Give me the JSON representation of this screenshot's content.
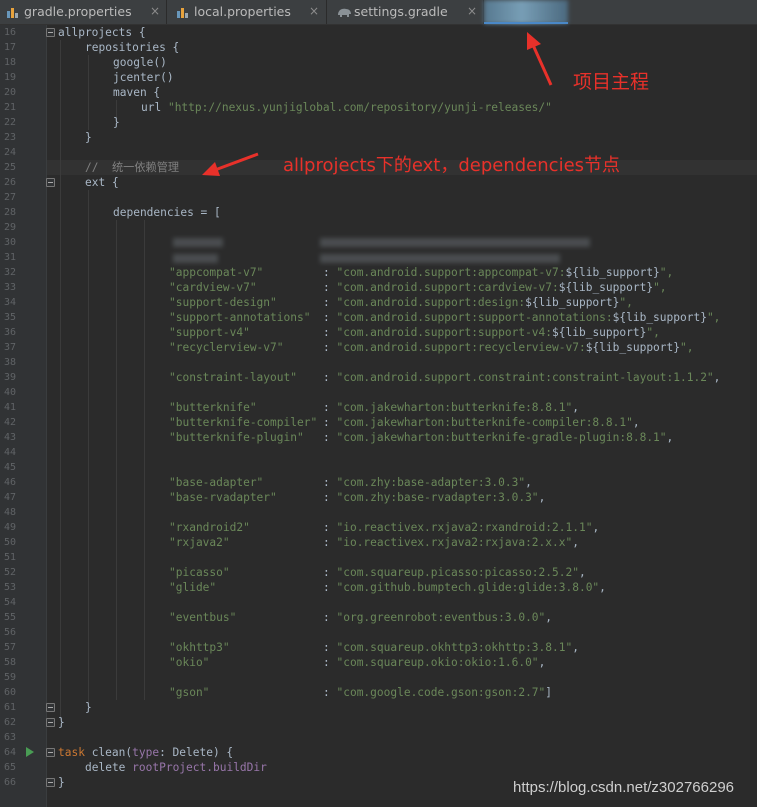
{
  "tabs": [
    {
      "label": "gradle.properties",
      "icon": "gradle-properties-icon",
      "close": "×"
    },
    {
      "label": "local.properties",
      "icon": "gradle-properties-icon",
      "close": "×"
    },
    {
      "label": "settings.gradle",
      "icon": "gradle-elephant-icon",
      "close": "×"
    }
  ],
  "line_numbers": [
    "16",
    "17",
    "18",
    "19",
    "20",
    "21",
    "22",
    "23",
    "24",
    "25",
    "26",
    "27",
    "28",
    "29",
    "30",
    "31",
    "32",
    "33",
    "34",
    "35",
    "36",
    "37",
    "38",
    "39",
    "40",
    "41",
    "42",
    "43",
    "44",
    "45",
    "46",
    "47",
    "48",
    "49",
    "50",
    "51",
    "52",
    "53",
    "54",
    "55",
    "56",
    "57",
    "58",
    "59",
    "60",
    "61",
    "62",
    "63",
    "64",
    "65",
    "66"
  ],
  "code": {
    "l16": "allprojects {",
    "l17": "repositories {",
    "l18": "google()",
    "l19": "jcenter()",
    "l20": "maven {",
    "l21_a": "url ",
    "l21_b": "\"http://nexus.yunjiglobal.com/repository/yunji-releases/\"",
    "l22": "}",
    "l23": "}",
    "l25": "//  统一依赖管理",
    "l26": "ext {",
    "l28": "dependencies = [",
    "deps": [
      {
        "key": "\"appcompat-v7\"",
        "val_a": "\"com.android.support:appcompat-v7:",
        "val_b": "${lib_support}",
        "val_c": "\","
      },
      {
        "key": "\"cardview-v7\"",
        "val_a": "\"com.android.support:cardview-v7:",
        "val_b": "${lib_support}",
        "val_c": "\","
      },
      {
        "key": "\"support-design\"",
        "val_a": "\"com.android.support:design:",
        "val_b": "${lib_support}",
        "val_c": "\","
      },
      {
        "key": "\"support-annotations\"",
        "val_a": "\"com.android.support:support-annotations:",
        "val_b": "${lib_support}",
        "val_c": "\","
      },
      {
        "key": "\"support-v4\"",
        "val_a": "\"com.android.support:support-v4:",
        "val_b": "${lib_support}",
        "val_c": "\","
      },
      {
        "key": "\"recyclerview-v7\"",
        "val_a": "\"com.android.support:recyclerview-v7:",
        "val_b": "${lib_support}",
        "val_c": "\","
      },
      {
        "key": "\"constraint-layout\"",
        "val_a": "\"com.android.support.constraint:constraint-layout:1.1.2\"",
        "val_b": "",
        "val_c": ","
      },
      {
        "key": "\"butterknife\"",
        "val_a": "\"com.jakewharton:butterknife:8.8.1\"",
        "val_b": "",
        "val_c": ","
      },
      {
        "key": "\"butterknife-compiler\"",
        "val_a": "\"com.jakewharton:butterknife-compiler:8.8.1\"",
        "val_b": "",
        "val_c": ","
      },
      {
        "key": "\"butterknife-plugin\"",
        "val_a": "\"com.jakewharton:butterknife-gradle-plugin:8.8.1\"",
        "val_b": "",
        "val_c": ","
      },
      {
        "key": "\"base-adapter\"",
        "val_a": "\"com.zhy:base-adapter:3.0.3\"",
        "val_b": "",
        "val_c": ","
      },
      {
        "key": "\"base-rvadapter\"",
        "val_a": "\"com.zhy:base-rvadapter:3.0.3\"",
        "val_b": "",
        "val_c": ","
      },
      {
        "key": "\"rxandroid2\"",
        "val_a": "\"io.reactivex.rxjava2:rxandroid:2.1.1\"",
        "val_b": "",
        "val_c": ","
      },
      {
        "key": "\"rxjava2\"",
        "val_a": "\"io.reactivex.rxjava2:rxjava:2.x.x\"",
        "val_b": "",
        "val_c": ","
      },
      {
        "key": "\"picasso\"",
        "val_a": "\"com.squareup.picasso:picasso:2.5.2\"",
        "val_b": "",
        "val_c": ","
      },
      {
        "key": "\"glide\"",
        "val_a": "\"com.github.bumptech.glide:glide:3.8.0\"",
        "val_b": "",
        "val_c": ","
      },
      {
        "key": "\"eventbus\"",
        "val_a": "\"org.greenrobot:eventbus:3.0.0\"",
        "val_b": "",
        "val_c": ","
      },
      {
        "key": "\"okhttp3\"",
        "val_a": "\"com.squareup.okhttp3:okhttp:3.8.1\"",
        "val_b": "",
        "val_c": ","
      },
      {
        "key": "\"okio\"",
        "val_a": "\"com.squareup.okio:okio:1.6.0\"",
        "val_b": "",
        "val_c": ","
      },
      {
        "key": "\"gson\"",
        "val_a": "\"com.google.code.gson:gson:2.7\"",
        "val_b": "",
        "val_c": "]"
      }
    ],
    "colon": ": ",
    "l61": "}",
    "l62": "}",
    "l63": "}",
    "l64_a": "task ",
    "l64_b": "clean(",
    "l64_c": "type",
    "l64_d": ": Delete) {",
    "l65_a": "delete ",
    "l65_b": "rootProject.buildDir",
    "l66": "}"
  },
  "annotations": {
    "main_project": "项目主程",
    "ext_node": "allprojects下的ext，dependencies节点"
  },
  "watermark": "https://blog.csdn.net/z302766296",
  "colors": {
    "annotation_red": "#e8312a",
    "string_green": "#6a8759",
    "keyword_orange": "#cc7832",
    "comment_gray": "#808080"
  }
}
